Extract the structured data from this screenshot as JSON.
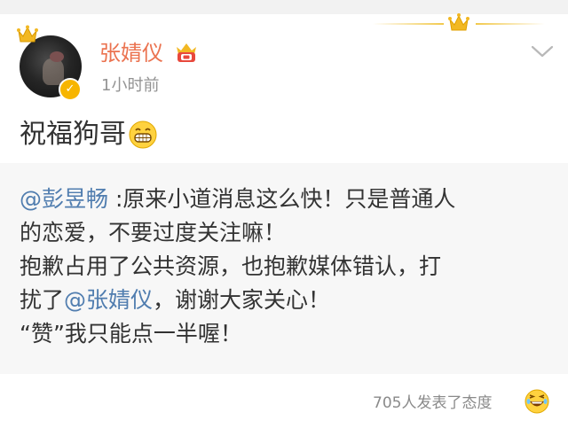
{
  "header": {
    "username": "张婧仪",
    "timestamp": "1小时前",
    "icons": [
      "crown-icon",
      "verified-badge-icon",
      "member-badge-icon",
      "chevron-down-icon"
    ]
  },
  "post": {
    "text": "祝福狗哥",
    "emoji": "grin-emoji"
  },
  "repost": {
    "line1_mention": "@彭昱畅",
    "line1_rest": " :原来小道消息这么快！只是普通人",
    "line2": "的恋爱，不要过度关注嘛！",
    "line3": "抱歉占用了公共资源，也抱歉媒体错认，打",
    "line4_pre": "扰了",
    "line4_mention": "@张婧仪",
    "line4_post": "，谢谢大家关心！",
    "line5": "“赞”我只能点一半喔！"
  },
  "footer": {
    "reactions_text": "705人发表了态度",
    "emoji": "laugh-emoji"
  },
  "colors": {
    "username": "#eb7350",
    "mention": "#507daf",
    "timestamp": "#939393",
    "repost_bg": "#f7f7f7",
    "gold": "#f7b500"
  }
}
